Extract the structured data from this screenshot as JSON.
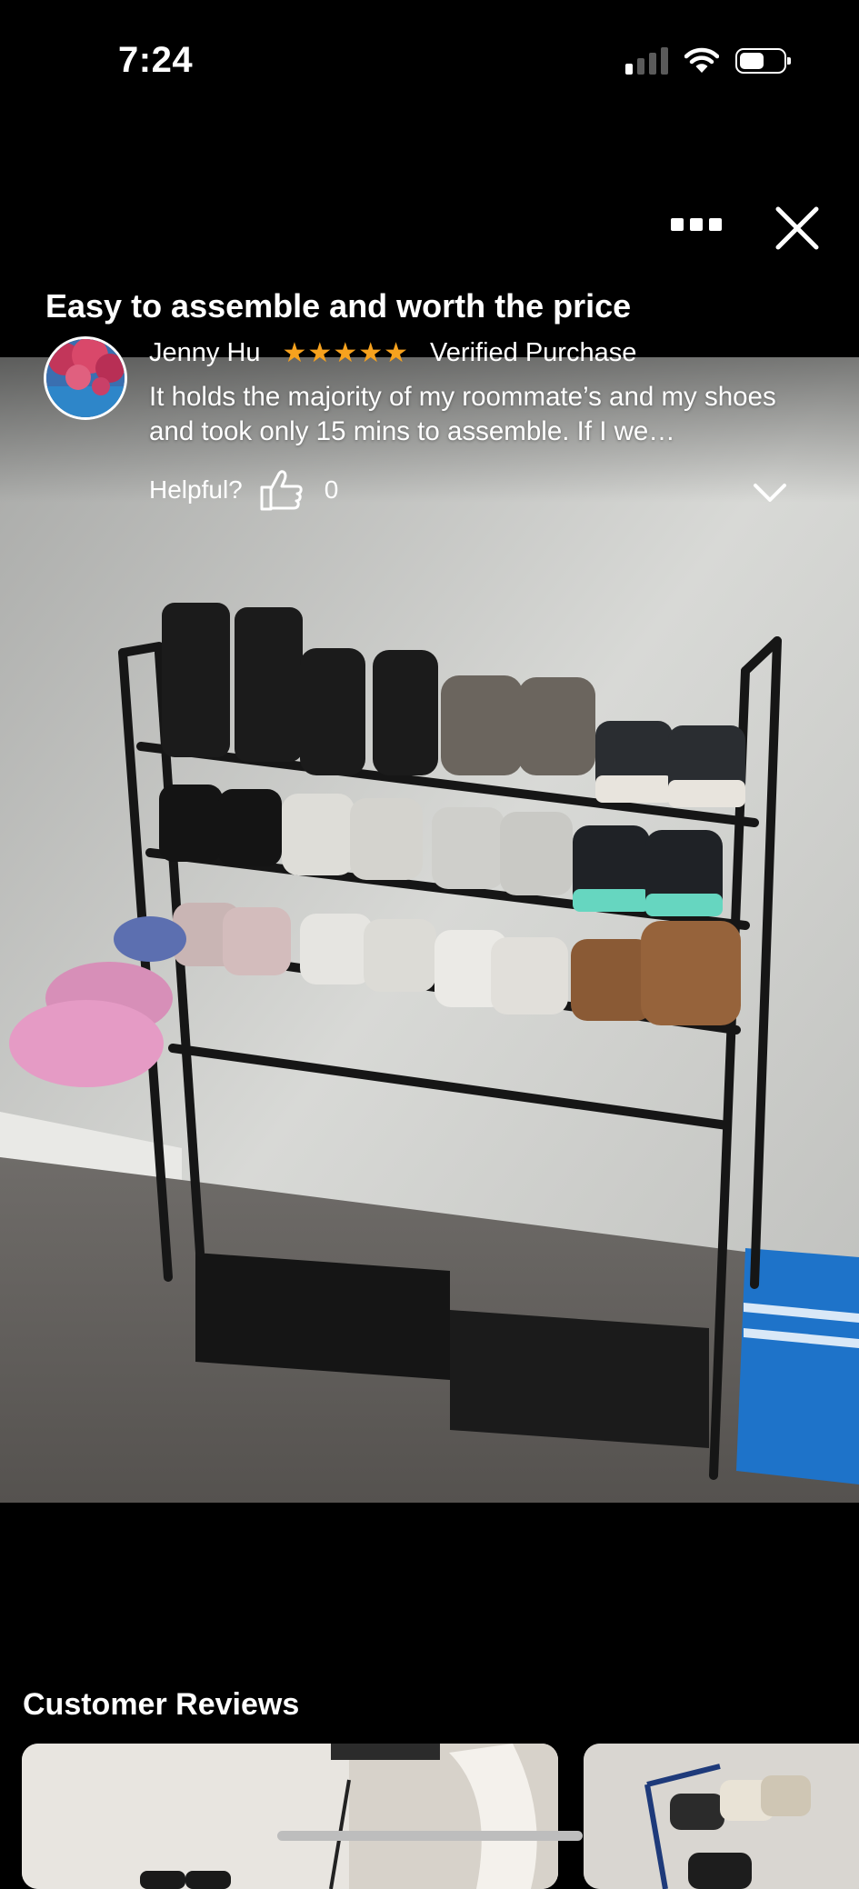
{
  "status_bar": {
    "time": "7:24"
  },
  "review": {
    "title": "Easy to assemble and worth the price",
    "reviewer": "Jenny Hu",
    "rating": 5,
    "badge": "Verified Purchase",
    "body": "It holds the majority of my roommate’s and my shoes and took only 15 mins to assemble. If I we…",
    "helpful_label": "Helpful?",
    "helpful_count": "0"
  },
  "section": {
    "title": "Customer Reviews"
  },
  "colors": {
    "star": "#f7a21e",
    "background": "#000000"
  },
  "icons": [
    "more-icon",
    "close-icon",
    "thumbs-up-icon",
    "chevron-down-icon",
    "wifi-icon",
    "battery-icon",
    "signal-icon"
  ]
}
